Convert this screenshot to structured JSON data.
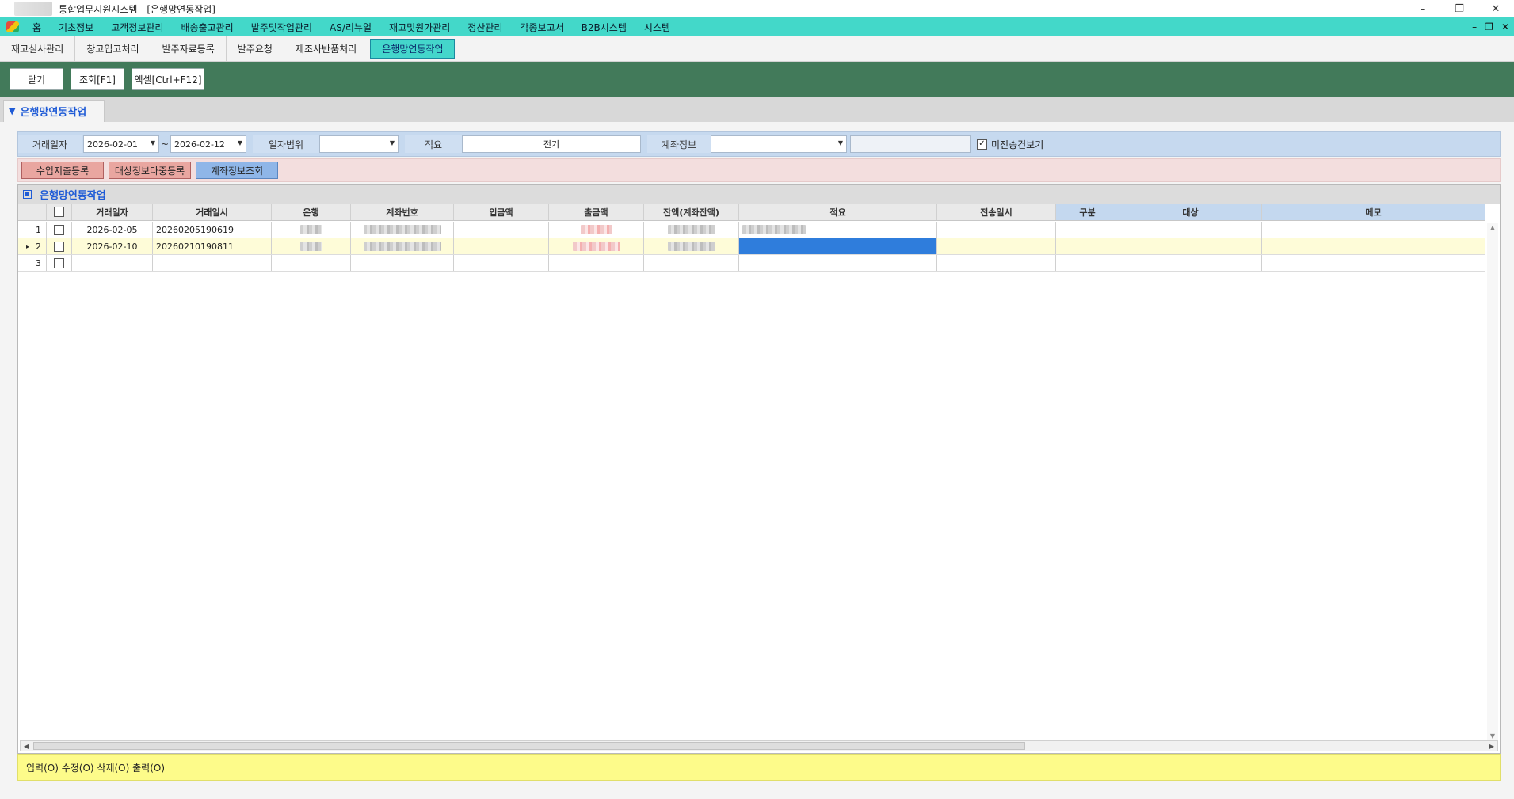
{
  "window": {
    "title": "통합업무지원시스템 - [은행망연동작업]"
  },
  "menu": [
    "홈",
    "기초정보",
    "고객정보관리",
    "배송출고관리",
    "발주및작업관리",
    "AS/리뉴얼",
    "재고및원가관리",
    "정산관리",
    "각종보고서",
    "B2B시스템",
    "시스템"
  ],
  "subtabs": [
    "재고실사관리",
    "창고입고처리",
    "발주자료등록",
    "발주요청",
    "제조사반품처리",
    "은행망연동작업"
  ],
  "toolbar": {
    "close": "닫기",
    "search": "조회[F1]",
    "excel": "엑셀[Ctrl+F12]"
  },
  "section": {
    "title": "은행망연동작업"
  },
  "filters": {
    "trade_date_label": "거래일자",
    "date_from": "2026-02-01",
    "tilde": "~",
    "date_to": "2026-02-12",
    "range_label": "일자범위",
    "range_value": "",
    "memo_label": "적요",
    "memo_value": "전기",
    "account_label": "계좌정보",
    "account_value": "",
    "account_extra": "",
    "unsent_label": "미전송건보기",
    "unsent_checked": "true"
  },
  "actions": {
    "register_io": "수입지출등록",
    "multi_register": "대상정보다중등록",
    "account_lookup": "계좌정보조회"
  },
  "grid": {
    "title": "은행망연동작업",
    "columns": [
      "거래일자",
      "거래일시",
      "은행",
      "계좌번호",
      "입금액",
      "출금액",
      "잔액(계좌잔액)",
      "적요",
      "전송일시",
      "구분",
      "대상",
      "메모"
    ],
    "rows": [
      {
        "num": "1",
        "date": "2026-02-05",
        "datetime": "20260205190619"
      },
      {
        "num": "2",
        "date": "2026-02-10",
        "datetime": "20260210190811"
      },
      {
        "num": "3",
        "date": "",
        "datetime": ""
      }
    ]
  },
  "status": {
    "text": "입력(O) 수정(O) 삭제(O) 출력(O)"
  }
}
